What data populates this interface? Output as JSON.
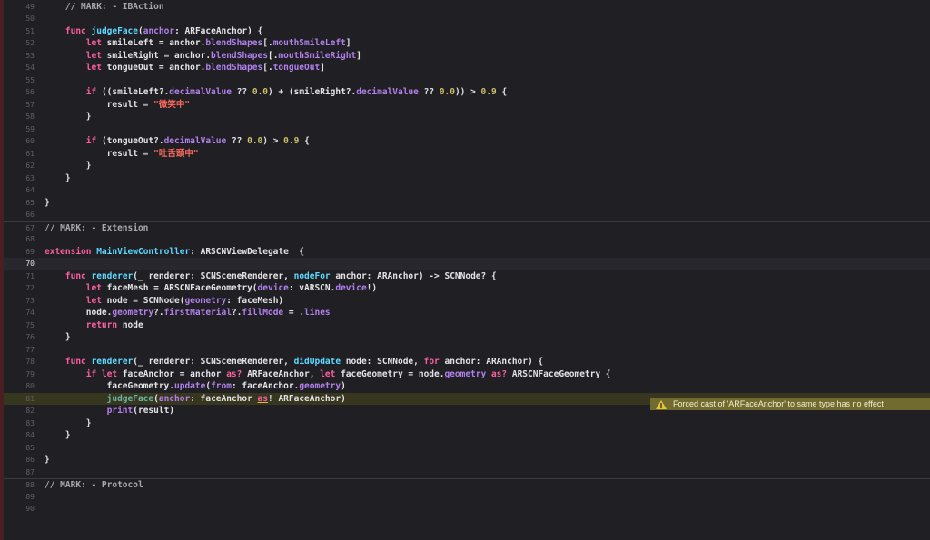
{
  "lines": [
    {
      "num": "49",
      "segs": [
        {
          "t": "    "
        },
        {
          "t": "// MARK: - IBAction",
          "c": "c"
        }
      ]
    },
    {
      "num": "50",
      "segs": []
    },
    {
      "num": "51",
      "segs": [
        {
          "t": "    "
        },
        {
          "t": "func",
          "c": "k"
        },
        {
          "t": " "
        },
        {
          "t": "judgeFace",
          "c": "t"
        },
        {
          "t": "("
        },
        {
          "t": "anchor",
          "c": "p"
        },
        {
          "t": ": ARFaceAnchor) {"
        }
      ]
    },
    {
      "num": "52",
      "segs": [
        {
          "t": "        "
        },
        {
          "t": "let",
          "c": "k"
        },
        {
          "t": " smileLeft = anchor."
        },
        {
          "t": "blendShapes",
          "c": "p"
        },
        {
          "t": "[."
        },
        {
          "t": "mouthSmileLeft",
          "c": "p"
        },
        {
          "t": "]"
        }
      ]
    },
    {
      "num": "53",
      "segs": [
        {
          "t": "        "
        },
        {
          "t": "let",
          "c": "k"
        },
        {
          "t": " smileRight = anchor."
        },
        {
          "t": "blendShapes",
          "c": "p"
        },
        {
          "t": "[."
        },
        {
          "t": "mouthSmileRight",
          "c": "p"
        },
        {
          "t": "]"
        }
      ]
    },
    {
      "num": "54",
      "segs": [
        {
          "t": "        "
        },
        {
          "t": "let",
          "c": "k"
        },
        {
          "t": " tongueOut = anchor."
        },
        {
          "t": "blendShapes",
          "c": "p"
        },
        {
          "t": "[."
        },
        {
          "t": "tongueOut",
          "c": "p"
        },
        {
          "t": "]"
        }
      ]
    },
    {
      "num": "55",
      "segs": []
    },
    {
      "num": "56",
      "segs": [
        {
          "t": "        "
        },
        {
          "t": "if",
          "c": "k"
        },
        {
          "t": " ((smileLeft?."
        },
        {
          "t": "decimalValue",
          "c": "p"
        },
        {
          "t": " ?? "
        },
        {
          "t": "0.0",
          "c": "n"
        },
        {
          "t": ") + (smileRight?."
        },
        {
          "t": "decimalValue",
          "c": "p"
        },
        {
          "t": " ?? "
        },
        {
          "t": "0.0",
          "c": "n"
        },
        {
          "t": ")) > "
        },
        {
          "t": "0.9",
          "c": "n"
        },
        {
          "t": " {"
        }
      ]
    },
    {
      "num": "57",
      "segs": [
        {
          "t": "            result = "
        },
        {
          "t": "\"微笑中\"",
          "c": "s"
        }
      ]
    },
    {
      "num": "58",
      "segs": [
        {
          "t": "        }"
        }
      ]
    },
    {
      "num": "59",
      "segs": []
    },
    {
      "num": "60",
      "segs": [
        {
          "t": "        "
        },
        {
          "t": "if",
          "c": "k"
        },
        {
          "t": " (tongueOut?."
        },
        {
          "t": "decimalValue",
          "c": "p"
        },
        {
          "t": " ?? "
        },
        {
          "t": "0.0",
          "c": "n"
        },
        {
          "t": ") > "
        },
        {
          "t": "0.9",
          "c": "n"
        },
        {
          "t": " {"
        }
      ]
    },
    {
      "num": "61",
      "segs": [
        {
          "t": "            result = "
        },
        {
          "t": "\"吐舌頭中\"",
          "c": "s"
        }
      ]
    },
    {
      "num": "62",
      "segs": [
        {
          "t": "        }"
        }
      ]
    },
    {
      "num": "63",
      "segs": [
        {
          "t": "    }"
        }
      ]
    },
    {
      "num": "64",
      "segs": []
    },
    {
      "num": "65",
      "segs": [
        {
          "t": "}"
        }
      ]
    },
    {
      "num": "66",
      "segs": []
    },
    {
      "num": "67",
      "segs": [
        {
          "t": "// MARK: - Extension",
          "c": "c"
        }
      ],
      "mark": true
    },
    {
      "num": "68",
      "segs": []
    },
    {
      "num": "69",
      "segs": [
        {
          "t": "extension",
          "c": "k"
        },
        {
          "t": " "
        },
        {
          "t": "MainViewController",
          "c": "t"
        },
        {
          "t": ": ARSCNViewDelegate  {"
        }
      ]
    },
    {
      "num": "70",
      "segs": [],
      "current": true
    },
    {
      "num": "71",
      "segs": [
        {
          "t": "    "
        },
        {
          "t": "func",
          "c": "k"
        },
        {
          "t": " "
        },
        {
          "t": "renderer",
          "c": "t"
        },
        {
          "t": "(_ renderer: SCNSceneRenderer, "
        },
        {
          "t": "nodeFor",
          "c": "t"
        },
        {
          "t": " anchor: ARAnchor) -> SCNNode? {"
        }
      ]
    },
    {
      "num": "72",
      "segs": [
        {
          "t": "        "
        },
        {
          "t": "let",
          "c": "k"
        },
        {
          "t": " faceMesh = ARSCNFaceGeometry("
        },
        {
          "t": "device",
          "c": "p"
        },
        {
          "t": ": vARSCN."
        },
        {
          "t": "device",
          "c": "p"
        },
        {
          "t": "!)"
        }
      ]
    },
    {
      "num": "73",
      "segs": [
        {
          "t": "        "
        },
        {
          "t": "let",
          "c": "k"
        },
        {
          "t": " node = SCNNode("
        },
        {
          "t": "geometry",
          "c": "p"
        },
        {
          "t": ": faceMesh)"
        }
      ]
    },
    {
      "num": "74",
      "segs": [
        {
          "t": "        node."
        },
        {
          "t": "geometry",
          "c": "p"
        },
        {
          "t": "?."
        },
        {
          "t": "firstMaterial",
          "c": "p"
        },
        {
          "t": "?."
        },
        {
          "t": "fillMode",
          "c": "p"
        },
        {
          "t": " = ."
        },
        {
          "t": "lines",
          "c": "p"
        }
      ]
    },
    {
      "num": "75",
      "segs": [
        {
          "t": "        "
        },
        {
          "t": "return",
          "c": "k"
        },
        {
          "t": " node"
        }
      ]
    },
    {
      "num": "76",
      "segs": [
        {
          "t": "    }"
        }
      ]
    },
    {
      "num": "77",
      "segs": []
    },
    {
      "num": "78",
      "segs": [
        {
          "t": "    "
        },
        {
          "t": "func",
          "c": "k"
        },
        {
          "t": " "
        },
        {
          "t": "renderer",
          "c": "t"
        },
        {
          "t": "(_ renderer: SCNSceneRenderer, "
        },
        {
          "t": "didUpdate",
          "c": "t"
        },
        {
          "t": " node: SCNNode, "
        },
        {
          "t": "for",
          "c": "k"
        },
        {
          "t": " anchor: ARAnchor) {"
        }
      ]
    },
    {
      "num": "79",
      "segs": [
        {
          "t": "        "
        },
        {
          "t": "if let",
          "c": "k"
        },
        {
          "t": " faceAnchor = anchor "
        },
        {
          "t": "as?",
          "c": "k"
        },
        {
          "t": " ARFaceAnchor, "
        },
        {
          "t": "let",
          "c": "k"
        },
        {
          "t": " faceGeometry = node."
        },
        {
          "t": "geometry",
          "c": "p"
        },
        {
          "t": " "
        },
        {
          "t": "as?",
          "c": "k"
        },
        {
          "t": " ARSCNFaceGeometry {"
        }
      ]
    },
    {
      "num": "80",
      "segs": [
        {
          "t": "            faceGeometry."
        },
        {
          "t": "update",
          "c": "p"
        },
        {
          "t": "("
        },
        {
          "t": "from",
          "c": "p"
        },
        {
          "t": ": faceAnchor."
        },
        {
          "t": "geometry",
          "c": "p"
        },
        {
          "t": ")"
        }
      ]
    },
    {
      "num": "81",
      "segs": [
        {
          "t": "            "
        },
        {
          "t": "judgeFace",
          "c": "f"
        },
        {
          "t": "("
        },
        {
          "t": "anchor",
          "c": "p"
        },
        {
          "t": ": faceAnchor "
        },
        {
          "t": "as",
          "c": "k u"
        },
        {
          "t": "! ARFaceAnchor)"
        }
      ],
      "warn": true
    },
    {
      "num": "82",
      "segs": [
        {
          "t": "            "
        },
        {
          "t": "print",
          "c": "p"
        },
        {
          "t": "(result)"
        }
      ]
    },
    {
      "num": "83",
      "segs": [
        {
          "t": "        }"
        }
      ]
    },
    {
      "num": "84",
      "segs": [
        {
          "t": "    }"
        }
      ]
    },
    {
      "num": "85",
      "segs": []
    },
    {
      "num": "86",
      "segs": [
        {
          "t": "}"
        }
      ]
    },
    {
      "num": "87",
      "segs": []
    },
    {
      "num": "88",
      "segs": [
        {
          "t": "// MARK: - Protocol",
          "c": "c"
        }
      ],
      "mark": true
    },
    {
      "num": "89",
      "segs": []
    },
    {
      "num": "90",
      "segs": []
    }
  ],
  "warning": {
    "icon": "warning-triangle-icon",
    "message": "Forced cast of 'ARFaceAnchor' to same type has no effect",
    "color": "#726b2f"
  },
  "colors": {
    "background": "#1f1f24",
    "keyword": "#fc5fa3",
    "type": "#5dd8ff",
    "property": "#b281eb",
    "string": "#fc6a5d",
    "number": "#d0bf69"
  }
}
